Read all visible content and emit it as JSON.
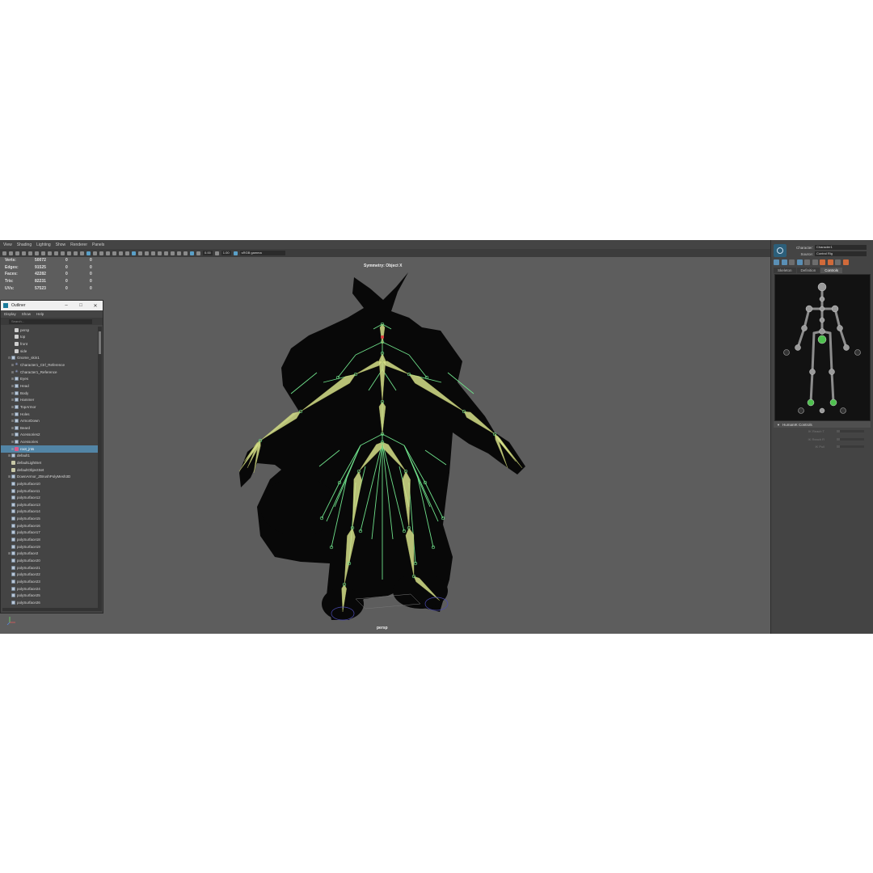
{
  "viewport": {
    "menu": [
      "View",
      "Shading",
      "Lighting",
      "Show",
      "Renderer",
      "Panels"
    ],
    "toolbar": {
      "field_a": "0.00",
      "field_b": "1.00",
      "color_space": "sRGB gamma"
    },
    "symmetry": "Symmetry: Object X",
    "camera": "persp",
    "hud": [
      {
        "label": "Verts:",
        "v1": "50072",
        "v2": "0",
        "v3": "0"
      },
      {
        "label": "Edges:",
        "v1": "91525",
        "v2": "0",
        "v3": "0"
      },
      {
        "label": "Faces:",
        "v1": "42282",
        "v2": "0",
        "v3": "0"
      },
      {
        "label": "Tris:",
        "v1": "82231",
        "v2": "0",
        "v3": "0"
      },
      {
        "label": "UVs:",
        "v1": "57523",
        "v2": "0",
        "v3": "0"
      }
    ]
  },
  "outliner": {
    "title": "Outliner",
    "menu": [
      "Display",
      "Show",
      "Help"
    ],
    "search_placeholder": "Search...",
    "items": [
      {
        "label": "persp",
        "icon": "camera-icon",
        "depth": 1,
        "exp": ""
      },
      {
        "label": "top",
        "icon": "camera-icon",
        "depth": 1,
        "exp": ""
      },
      {
        "label": "front",
        "icon": "camera-icon",
        "depth": 1,
        "exp": ""
      },
      {
        "label": "side",
        "icon": "camera-icon",
        "depth": 1,
        "exp": ""
      },
      {
        "label": "Gnome_skin1",
        "icon": "mesh-icon",
        "depth": 0,
        "exp": "⊟"
      },
      {
        "label": "Character1_Ctrl_Reference",
        "icon": "reference-icon",
        "depth": 1,
        "exp": "⊞"
      },
      {
        "label": "Character1_Reference",
        "icon": "reference-icon",
        "depth": 1,
        "exp": "⊞"
      },
      {
        "label": "Eyes",
        "icon": "mesh-icon",
        "depth": 1,
        "exp": "⊞"
      },
      {
        "label": "Head",
        "icon": "mesh-icon",
        "depth": 1,
        "exp": "⊞"
      },
      {
        "label": "Body",
        "icon": "mesh-icon",
        "depth": 1,
        "exp": "⊞"
      },
      {
        "label": "Hammer",
        "icon": "mesh-icon",
        "depth": 1,
        "exp": "⊞"
      },
      {
        "label": "TopArmor",
        "icon": "mesh-icon",
        "depth": 1,
        "exp": "⊞"
      },
      {
        "label": "Holes",
        "icon": "mesh-icon",
        "depth": 1,
        "exp": "⊞"
      },
      {
        "label": "ArmorDown",
        "icon": "mesh-icon",
        "depth": 1,
        "exp": "⊞"
      },
      {
        "label": "Beard",
        "icon": "mesh-icon",
        "depth": 1,
        "exp": "⊞"
      },
      {
        "label": "Acessories2",
        "icon": "mesh-icon",
        "depth": 1,
        "exp": "⊞"
      },
      {
        "label": "Acessories",
        "icon": "mesh-icon",
        "depth": 1,
        "exp": "⊞"
      },
      {
        "label": "root_jnts",
        "icon": "joint-icon",
        "depth": 1,
        "exp": "⊞",
        "selected": true
      },
      {
        "label": "default1",
        "icon": "mesh-icon",
        "depth": 0,
        "exp": "⊞"
      },
      {
        "label": "defaultLightSet",
        "icon": "set-icon",
        "depth": 0,
        "exp": ""
      },
      {
        "label": "defaultObjectSet",
        "icon": "set-icon",
        "depth": 0,
        "exp": ""
      },
      {
        "label": "DownArmor_ZBrushPolyMesh3D",
        "icon": "mesh-icon",
        "depth": 0,
        "exp": "⊞"
      },
      {
        "label": "polySurface10",
        "icon": "mesh-icon",
        "depth": 0,
        "exp": ""
      },
      {
        "label": "polySurface11",
        "icon": "mesh-icon",
        "depth": 0,
        "exp": ""
      },
      {
        "label": "polySurface12",
        "icon": "mesh-icon",
        "depth": 0,
        "exp": ""
      },
      {
        "label": "polySurface13",
        "icon": "mesh-icon",
        "depth": 0,
        "exp": ""
      },
      {
        "label": "polySurface14",
        "icon": "mesh-icon",
        "depth": 0,
        "exp": ""
      },
      {
        "label": "polySurface15",
        "icon": "mesh-icon",
        "depth": 0,
        "exp": ""
      },
      {
        "label": "polySurface16",
        "icon": "mesh-icon",
        "depth": 0,
        "exp": ""
      },
      {
        "label": "polySurface17",
        "icon": "mesh-icon",
        "depth": 0,
        "exp": ""
      },
      {
        "label": "polySurface18",
        "icon": "mesh-icon",
        "depth": 0,
        "exp": ""
      },
      {
        "label": "polySurface19",
        "icon": "mesh-icon",
        "depth": 0,
        "exp": ""
      },
      {
        "label": "polySurface2",
        "icon": "mesh-icon",
        "depth": 0,
        "exp": "⊞"
      },
      {
        "label": "polySurface20",
        "icon": "mesh-icon",
        "depth": 0,
        "exp": ""
      },
      {
        "label": "polySurface21",
        "icon": "mesh-icon",
        "depth": 0,
        "exp": ""
      },
      {
        "label": "polySurface22",
        "icon": "mesh-icon",
        "depth": 0,
        "exp": ""
      },
      {
        "label": "polySurface23",
        "icon": "mesh-icon",
        "depth": 0,
        "exp": ""
      },
      {
        "label": "polySurface24",
        "icon": "mesh-icon",
        "depth": 0,
        "exp": ""
      },
      {
        "label": "polySurface25",
        "icon": "mesh-icon",
        "depth": 0,
        "exp": ""
      },
      {
        "label": "polySurface26",
        "icon": "mesh-icon",
        "depth": 0,
        "exp": ""
      }
    ]
  },
  "hik": {
    "character_label": "Character:",
    "character_value": "Character1",
    "source_label": "Source:",
    "source_value": "Control Rig",
    "tabs": [
      "Skeleton",
      "Definition",
      "Controls"
    ],
    "active_tab": 2,
    "controls_header": "HumanIK Controls",
    "params": [
      "IK Reach T",
      "IK Reach R",
      "IK Pull"
    ]
  },
  "colors": {
    "joint_green": "#6ee08a",
    "bone_yellow": "#d6e08a",
    "selection_blue": "#5285a6",
    "viewport_bg": "#5d5d5d"
  }
}
